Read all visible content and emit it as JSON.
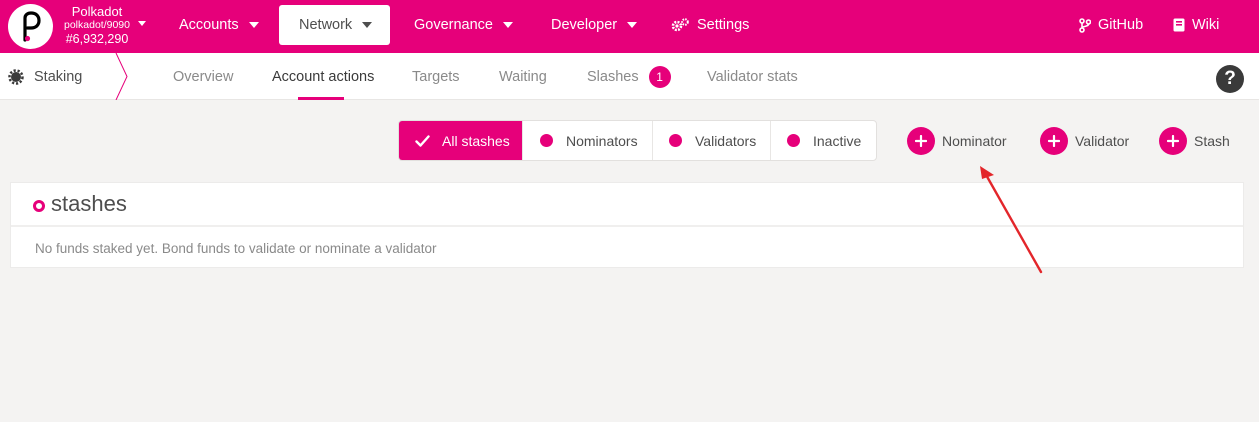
{
  "colors": {
    "accent": "#e6007a",
    "annotation_arrow": "#e3262b"
  },
  "chain": {
    "name": "Polkadot",
    "node": "polkadot/9090",
    "block": "#6,932,290"
  },
  "nav": {
    "accounts": "Accounts",
    "network": "Network",
    "governance": "Governance",
    "developer": "Developer",
    "settings": "Settings",
    "github": "GitHub",
    "wiki": "Wiki"
  },
  "subnav": {
    "section": "Staking",
    "tabs": [
      {
        "label": "Overview"
      },
      {
        "label": "Account actions"
      },
      {
        "label": "Targets"
      },
      {
        "label": "Waiting"
      },
      {
        "label": "Slashes",
        "badge": "1"
      },
      {
        "label": "Validator stats"
      }
    ],
    "active_tab": "Account actions",
    "help": "?"
  },
  "filters": [
    {
      "label": "All stashes",
      "active": true
    },
    {
      "label": "Nominators"
    },
    {
      "label": "Validators"
    },
    {
      "label": "Inactive"
    }
  ],
  "actions": [
    {
      "label": "Nominator"
    },
    {
      "label": "Validator"
    },
    {
      "label": "Stash"
    }
  ],
  "stashes": {
    "title": "stashes",
    "empty": "No funds staked yet. Bond funds to validate or nominate a validator"
  },
  "icons": {
    "logo": "polkadot-logo",
    "settings": "gears-icon",
    "github": "code-branch-icon",
    "wiki": "book-icon",
    "section": "staking-gear-icon",
    "help": "question-circle-icon",
    "filter_active": "check-icon",
    "action": "plus-icon"
  }
}
